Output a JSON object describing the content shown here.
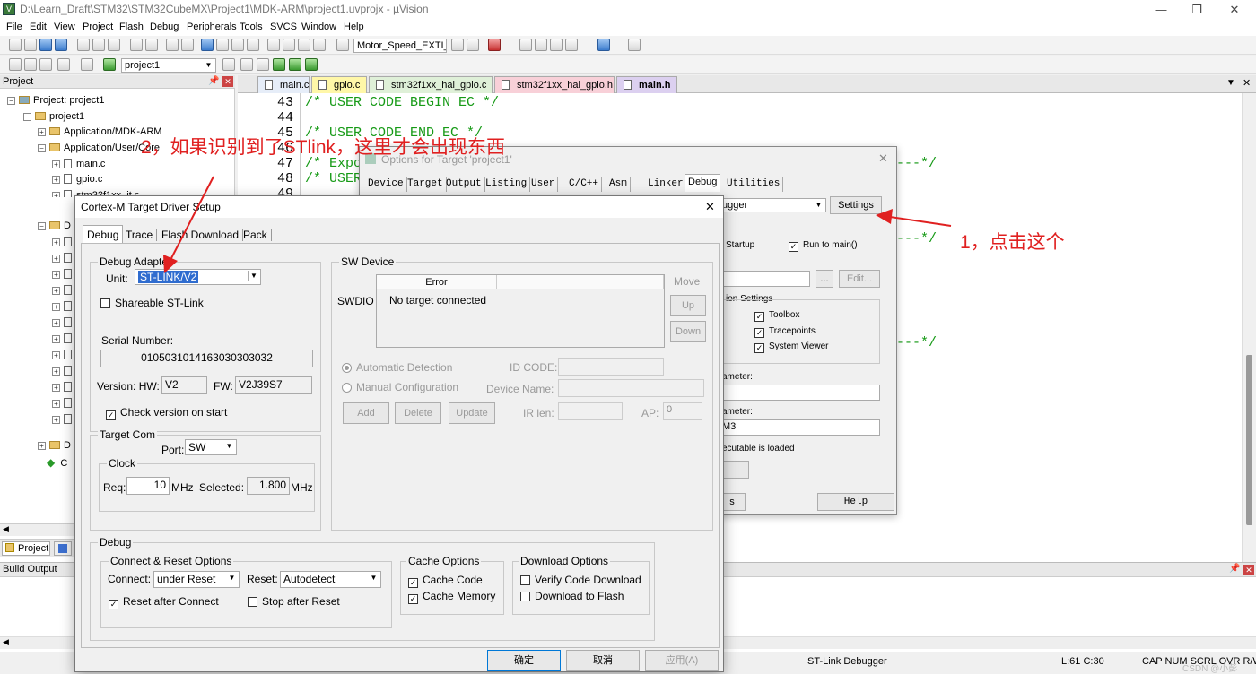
{
  "window": {
    "title": "D:\\Learn_Draft\\STM32\\STM32CubeMX\\Project1\\MDK-ARM\\project1.uvprojx - µVision"
  },
  "menu": [
    "File",
    "Edit",
    "View",
    "Project",
    "Flash",
    "Debug",
    "Peripherals",
    "Tools",
    "SVCS",
    "Window",
    "Help"
  ],
  "toolbar": {
    "target_combo": "Motor_Speed_EXTI_I",
    "project_combo": "project1"
  },
  "project_panel": {
    "header": "Project",
    "root": "Project: project1",
    "target": "project1",
    "groups": [
      "Application/MDK-ARM",
      "Application/User/Core"
    ],
    "files": [
      "main.c",
      "gpio.c",
      "stm32f1xx_it.c"
    ],
    "collapsed_prefix": [
      "D",
      "D",
      "C"
    ],
    "tab_project": "Project"
  },
  "editor": {
    "tabs": [
      "main.c",
      "gpio.c",
      "stm32f1xx_hal_gpio.c",
      "stm32f1xx_hal_gpio.h",
      "main.h"
    ],
    "lines": [
      {
        "no": "43",
        "text": "/* USER CODE BEGIN EC */"
      },
      {
        "no": "44",
        "text": ""
      },
      {
        "no": "45",
        "text": "/* USER CODE END EC */"
      },
      {
        "no": "46",
        "text": ""
      },
      {
        "no": "47",
        "text": "/* Expo"
      },
      {
        "no": "48",
        "text": "/* USER"
      },
      {
        "no": "49",
        "text": ""
      }
    ],
    "fragments": [
      "---*/",
      "---*/",
      "---*/"
    ]
  },
  "build_output": {
    "header": "Build Output"
  },
  "status_bar": {
    "debugger": "ST-Link Debugger",
    "position": "L:61 C:30",
    "flags": "CAP  NUM  SCRL  OVR  R/W"
  },
  "options_dialog": {
    "title": "Options for Target 'project1'",
    "tabs": [
      "Device",
      "Target",
      "Output",
      "Listing",
      "User",
      "C/C++",
      "Asm",
      "Linker",
      "Debug",
      "Utilities"
    ],
    "debugger_combo": "ugger",
    "settings_button": "Settings",
    "startup_label": "Startup",
    "run_to_main": "Run to main()",
    "edit_button": "Edit...",
    "browse_button": "...",
    "restore_group": "ion Settings",
    "toolbox": "Toolbox",
    "tracepoints": "Tracepoints",
    "system_viewer": "System Viewer",
    "param1_label": "ameter:",
    "param2_label": "ameter:",
    "param2_value": "M3",
    "loaded_label": "ecutable is loaded",
    "stub_button": "s",
    "help_button": "Help"
  },
  "cortex_dialog": {
    "title": "Cortex-M Target Driver Setup",
    "tabs": [
      "Debug",
      "Trace",
      "Flash Download",
      "Pack"
    ],
    "debug_adapter": {
      "group": "Debug Adapter",
      "unit_label": "Unit:",
      "unit_value": "ST-LINK/V2",
      "shareable": "Shareable ST-Link",
      "serial_label": "Serial Number:",
      "serial_value": "0105031014163030303032",
      "version_label": "Version: HW:",
      "hw_value": "V2",
      "fw_label": "FW:",
      "fw_value": "V2J39S7",
      "check_version": "Check version on start"
    },
    "target_com": {
      "group": "Target Com",
      "port_label": "Port:",
      "port_value": "SW",
      "clock_group": "Clock",
      "req_label": "Req:",
      "req_value": "10",
      "mhz1": "MHz",
      "selected_label": "Selected:",
      "selected_value": "1.800",
      "mhz2": "MHz"
    },
    "sw_device": {
      "group": "SW Device",
      "swdio": "SWDIO",
      "col_error": "Error",
      "row_text": "No target connected",
      "move": "Move",
      "up": "Up",
      "down": "Down",
      "auto_detect": "Automatic Detection",
      "manual_config": "Manual Configuration",
      "id_code": "ID CODE:",
      "device_name": "Device Name:",
      "add": "Add",
      "delete": "Delete",
      "update": "Update",
      "ir_len": "IR len:",
      "ap": "AP:",
      "ap_value": "0"
    },
    "debug": {
      "group": "Debug",
      "connect_reset_group": "Connect & Reset Options",
      "connect_label": "Connect:",
      "connect_value": "under Reset",
      "reset_label": "Reset:",
      "reset_value": "Autodetect",
      "reset_after_connect": "Reset after Connect",
      "stop_after_reset": "Stop after Reset",
      "cache_group": "Cache Options",
      "cache_code": "Cache Code",
      "cache_memory": "Cache Memory",
      "download_group": "Download Options",
      "verify_code": "Verify Code Download",
      "download_flash": "Download to Flash"
    },
    "buttons": {
      "ok": "确定",
      "cancel": "取消",
      "apply": "应用(A)"
    }
  },
  "annotations": {
    "step1": "1，点击这个",
    "step2": "2，如果识别到了STlink，这里才会出现东西"
  },
  "watermark": "CSDN @小彭"
}
